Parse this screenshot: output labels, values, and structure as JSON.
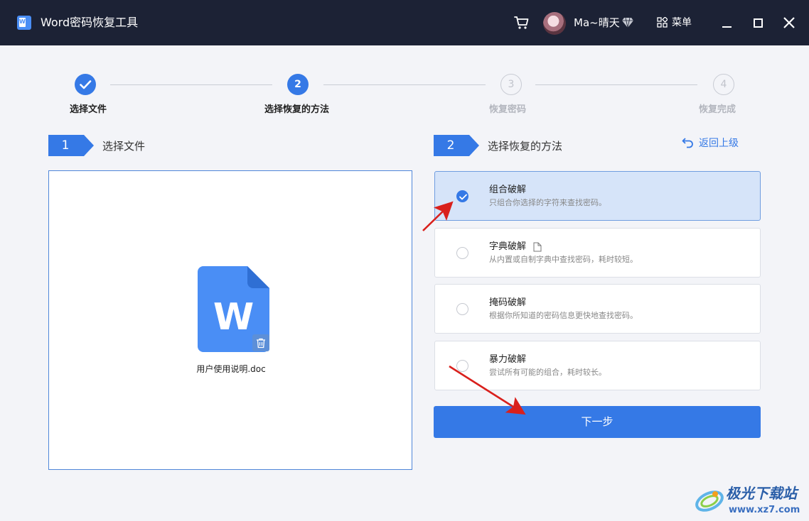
{
  "window": {
    "title": "Word密码恢复工具",
    "username": "Ma~晴天",
    "menu_label": "菜单"
  },
  "stepper": [
    {
      "number": "",
      "label": "选择文件",
      "state": "done"
    },
    {
      "number": "2",
      "label": "选择恢复的方法",
      "state": "active"
    },
    {
      "number": "3",
      "label": "恢复密码",
      "state": "todo"
    },
    {
      "number": "4",
      "label": "恢复完成",
      "state": "todo"
    }
  ],
  "left_section": {
    "number": "1",
    "title": "选择文件"
  },
  "right_section": {
    "number": "2",
    "title": "选择恢复的方法",
    "back_label": "返回上级"
  },
  "file": {
    "icon_letter": "W",
    "name": "用户使用说明.doc"
  },
  "methods": [
    {
      "name": "组合破解",
      "desc": "只组合你选择的字符来查找密码。",
      "selected": true
    },
    {
      "name": "字典破解",
      "desc": "从内置或自制字典中查找密码，耗时较短。",
      "selected": false
    },
    {
      "name": "掩码破解",
      "desc": "根据你所知道的密码信息更快地查找密码。",
      "selected": false
    },
    {
      "name": "暴力破解",
      "desc": "尝试所有可能的组合，耗时较长。",
      "selected": false
    }
  ],
  "next_label": "下一步",
  "watermark": {
    "name": "极光下载站",
    "url": "www.xz7.com"
  },
  "colors": {
    "accent": "#3579e6",
    "titlebar": "#1c2235",
    "selected_bg": "#d6e4f9",
    "arrow": "#d9201c"
  }
}
